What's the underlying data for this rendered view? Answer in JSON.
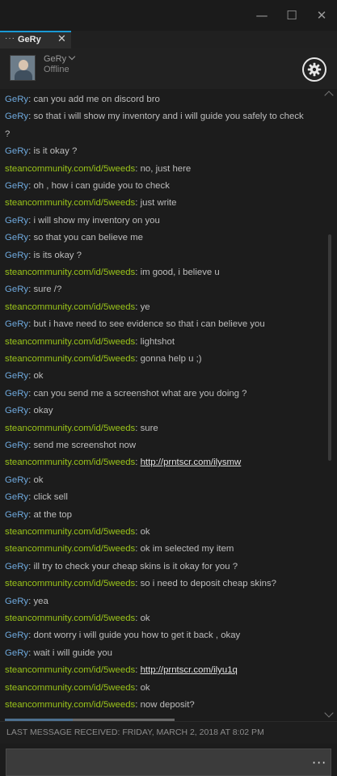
{
  "window": {
    "minimize_glyph": "—",
    "maximize_glyph": "☐",
    "close_glyph": "✕"
  },
  "tab": {
    "dots": "···",
    "name": "GeRy",
    "close_glyph": "✕"
  },
  "friend": {
    "name": "GeRy",
    "status": "Offline",
    "avatar_icon": "user-avatar",
    "settings_icon": "gear-icon"
  },
  "messages": [
    {
      "sender": "GeRy",
      "text": "can you add me on discord bro"
    },
    {
      "sender": "GeRy",
      "text": "so that i will show my inventory and i will guide you safely to check ?"
    },
    {
      "sender": "GeRy",
      "text": "is it okay ?"
    },
    {
      "sender": "steancommunity.com/id/5weeds",
      "text": "no, just here"
    },
    {
      "sender": "GeRy",
      "text": "oh , how i can guide you to check"
    },
    {
      "sender": "steancommunity.com/id/5weeds",
      "text": "just write"
    },
    {
      "sender": "GeRy",
      "text": "i will show my inventory on you"
    },
    {
      "sender": "GeRy",
      "text": "so that you can believe me"
    },
    {
      "sender": "GeRy",
      "text": "is its okay ?"
    },
    {
      "sender": "steancommunity.com/id/5weeds",
      "text": "im good, i believe u"
    },
    {
      "sender": "GeRy",
      "text": "sure /?"
    },
    {
      "sender": "steancommunity.com/id/5weeds",
      "text": "ye"
    },
    {
      "sender": "GeRy",
      "text": "but i have need to see evidence so that i can believe you"
    },
    {
      "sender": "steancommunity.com/id/5weeds",
      "text": "lightshot"
    },
    {
      "sender": "steancommunity.com/id/5weeds",
      "text": "gonna help u ;)"
    },
    {
      "sender": "GeRy",
      "text": "ok"
    },
    {
      "sender": "GeRy",
      "text": "can you send me a screenshot what are you doing ?"
    },
    {
      "sender": "GeRy",
      "text": "okay"
    },
    {
      "sender": "steancommunity.com/id/5weeds",
      "text": "sure"
    },
    {
      "sender": "GeRy",
      "text": "send me screenshot now"
    },
    {
      "sender": "steancommunity.com/id/5weeds",
      "text": "http://prntscr.com/ilysmw",
      "link": true
    },
    {
      "sender": "GeRy",
      "text": "ok"
    },
    {
      "sender": "GeRy",
      "text": "click sell"
    },
    {
      "sender": "GeRy",
      "text": "at the top"
    },
    {
      "sender": "steancommunity.com/id/5weeds",
      "text": "ok"
    },
    {
      "sender": "steancommunity.com/id/5weeds",
      "text": "ok im selected my item"
    },
    {
      "sender": "GeRy",
      "text": "ill try to check your cheap skins is it okay for you ?"
    },
    {
      "sender": "steancommunity.com/id/5weeds",
      "text": "so i need to deposit cheap skins?"
    },
    {
      "sender": "GeRy",
      "text": "yea"
    },
    {
      "sender": "steancommunity.com/id/5weeds",
      "text": "ok"
    },
    {
      "sender": "GeRy",
      "text": "dont worry i will guide you how to get it back , okay"
    },
    {
      "sender": "GeRy",
      "text": "wait i will guide you"
    },
    {
      "sender": "steancommunity.com/id/5weeds",
      "text": "http://prntscr.com/ilyu1q",
      "link": true
    },
    {
      "sender": "steancommunity.com/id/5weeds",
      "text": "ok"
    },
    {
      "sender": "steancommunity.com/id/5weeds",
      "text": "now deposit?"
    }
  ],
  "status_bar": {
    "last_message": "LAST MESSAGE RECEIVED: FRIDAY, MARCH 2, 2018 AT 8:02 PM"
  },
  "input": {
    "more_glyph": "···"
  },
  "colors": {
    "gery": "#6ea8dc",
    "steam_user": "#9ac41a",
    "text": "#bdbdbd",
    "tab_accent": "#1999d4"
  }
}
